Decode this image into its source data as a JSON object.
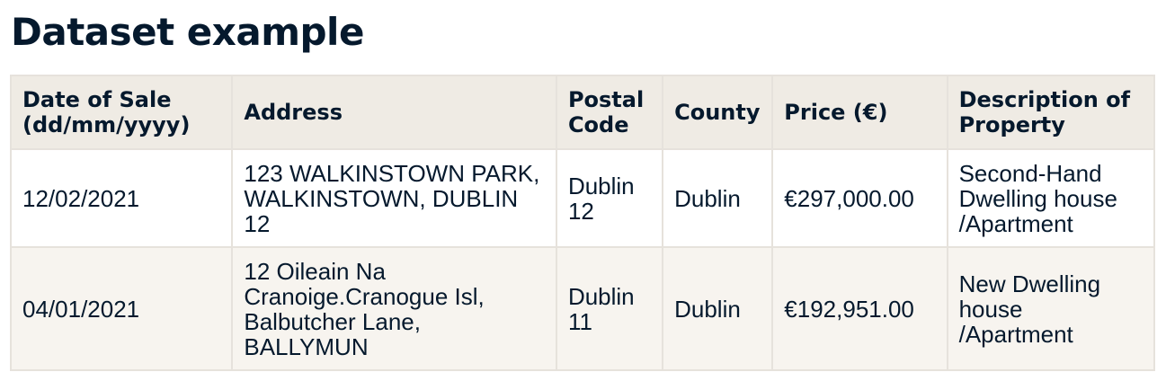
{
  "title": "Dataset example",
  "table": {
    "headers": [
      "Date of Sale (dd/mm/yyyy)",
      "Address",
      "Postal Code",
      "County",
      "Price (€)",
      "Description of Property"
    ],
    "rows": [
      [
        "12/02/2021",
        "123 WALKINSTOWN PARK, WALKINSTOWN, DUBLIN 12",
        "Dublin 12",
        "Dublin",
        "€297,000.00",
        "Second-Hand Dwelling house /Apartment"
      ],
      [
        "04/01/2021",
        "12 Oileain Na Cranoige.Cranogue Isl, Balbutcher Lane, BALLYMUN",
        "Dublin 11",
        "Dublin",
        "€192,951.00",
        "New Dwelling house /Apartment"
      ]
    ]
  },
  "colors": {
    "text": "#05192d",
    "header_bg": "#efebe4",
    "row_alt_bg": "#f7f4ef",
    "border": "#e6e2dc"
  }
}
